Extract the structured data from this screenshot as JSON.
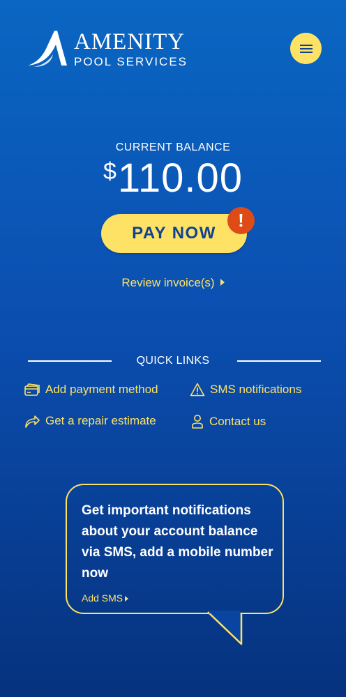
{
  "header": {
    "logo_title": "AMENITY",
    "logo_subtitle": "POOL SERVICES",
    "menu_icon": "hamburger-menu-icon"
  },
  "balance": {
    "label": "CURRENT BALANCE",
    "currency": "$",
    "amount": "110.00"
  },
  "pay": {
    "label": "PAY NOW",
    "alert_glyph": "!"
  },
  "review": {
    "label": "Review invoice(s)"
  },
  "quick_links": {
    "title": "QUICK LINKS",
    "items": [
      {
        "label": "Add payment method",
        "icon": "credit-card-icon"
      },
      {
        "label": "SMS notifications",
        "icon": "warning-triangle-icon"
      },
      {
        "label": "Get a repair estimate",
        "icon": "share-arrow-icon"
      },
      {
        "label": "Contact us",
        "icon": "person-icon"
      }
    ]
  },
  "sms_prompt": {
    "message": "Get important notifications about your account balance via SMS, add a mobile number now",
    "link": "Add SMS"
  },
  "colors": {
    "accent_yellow": "#fde265",
    "alert_orange": "#de4b17",
    "button_text": "#12418f",
    "bg_top": "#0a66c2",
    "bg_bottom": "#06327e"
  }
}
